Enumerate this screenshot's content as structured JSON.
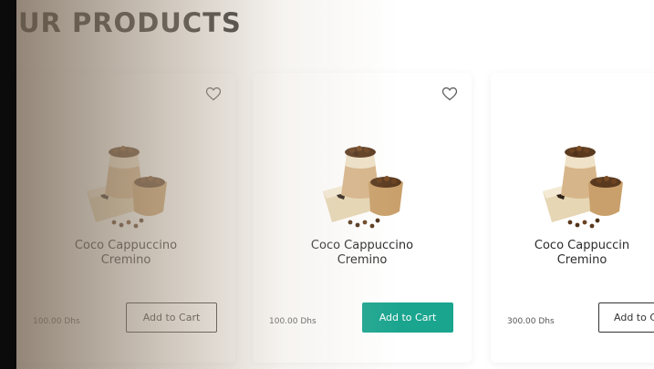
{
  "section": {
    "title": "UR PRODUCTS"
  },
  "products": [
    {
      "name_line1": "Coco Cappuccino",
      "name_line2": "Cremino",
      "price": "100.00 Dhs",
      "button": "Add to Cart",
      "button_state": "default"
    },
    {
      "name_line1": "Coco Cappuccino",
      "name_line2": "Cremino",
      "price": "100.00 Dhs",
      "button": "Add to Cart",
      "button_state": "hover"
    },
    {
      "name_line1": "Coco Cappuccin",
      "name_line2": "Cremino",
      "price": "300.00 Dhs",
      "button": "Add to C",
      "button_state": "default"
    }
  ],
  "icons": {
    "favorite": "heart-icon",
    "product": "product-image-icon"
  },
  "colors": {
    "accent": "#1aa58f",
    "title": "#1f1f1f",
    "left_bar": "#0b0b0b"
  }
}
